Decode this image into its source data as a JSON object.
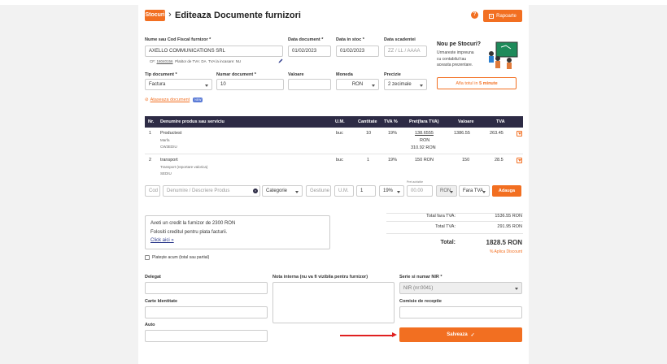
{
  "header": {
    "section_badge": "Stocuri",
    "crumb_edit": "Editeaza",
    "crumb_current": "Documente furnizori",
    "help_glyph": "?",
    "reports_button": "Rapoarte"
  },
  "form": {
    "supplier": {
      "label": "Nume sau Cod Fiscal furnizor *",
      "value": "AXELLO COMMUNICATIONS SRL",
      "cif_prefix": "CF:",
      "cif_value": "18040156",
      "tva_note": "Platitor de TVA: DA",
      "tva_cash": "TVA la incasare: NU"
    },
    "doc_date": {
      "label": "Data document *",
      "value": "01/02/2023"
    },
    "stock_date": {
      "label": "Data in stoc *",
      "value": "01/02/2023"
    },
    "due_date": {
      "label": "Data scadentei",
      "placeholder": "ZZ / LL / AAAA"
    },
    "doc_type": {
      "label": "Tip document *",
      "value": "Factura"
    },
    "doc_number": {
      "label": "Numar document *",
      "value": "10"
    },
    "amount": {
      "label": "Valoare",
      "value": ""
    },
    "currency": {
      "label": "Moneda",
      "value": "RON"
    },
    "precision": {
      "label": "Precizie",
      "value": "2 zecimale"
    },
    "attach": {
      "label": "Ataseaza document",
      "badge": "NEW"
    }
  },
  "promo": {
    "title": "Nou pe Stocuri?",
    "text1": "Urmareste impreuna",
    "text2": "cu contabilul tau",
    "text3": "aceasta prezentare.",
    "button_prefix": "Afla totul in ",
    "button_bold": "5 minute"
  },
  "table": {
    "headers": [
      "Nr.",
      "Denumire produs sau serviciu",
      "U.M.",
      "Cantitate",
      "TVA %",
      "Pret(fara TVA)",
      "Valoare",
      "TVA"
    ],
    "rows": [
      {
        "nr": "1",
        "name": "Productest",
        "type": "Marfa",
        "code": "CW3EDIU",
        "um": "buc",
        "qty": "10",
        "vat": "19%",
        "price": "138.6555",
        "price_cur": "RON",
        "price_note": "310.92 RON",
        "value": "1386.55",
        "vat_value": "263.45"
      },
      {
        "nr": "2",
        "name": "transport",
        "type": "Transport (reportare valorica)",
        "code": "SEDIU",
        "um": "buc",
        "qty": "1",
        "vat": "19%",
        "price": "150 RON",
        "price_cur": "",
        "price_note": "",
        "value": "150",
        "vat_value": "28.5"
      }
    ]
  },
  "add_row": {
    "code_ph": "Cod",
    "name_ph": "Denumire / Descriere Produs",
    "category": "Categorie",
    "location_ph": "Gestiune",
    "um_ph": "U.M.",
    "qty": "1",
    "vat": "19%",
    "price_label": "Pret achizitie",
    "price_ph": "00.00",
    "currency": "RON",
    "vat_mode": "Fara TVA",
    "add_button": "Adauga"
  },
  "totals": {
    "no_vat_label": "Total fara TVA:",
    "no_vat_value": "1536.55 RON",
    "vat_label": "Total TVA:",
    "vat_value": "291.95 RON",
    "total_label": "Total:",
    "total_value": "1828.5 RON",
    "discount": "% Aplica Discount"
  },
  "credit": {
    "line1": "Aveti un credit la furnizor de 2300 RON",
    "line2": "Folositi creditul pentru plata facturii.",
    "link": "Click aici »",
    "paid_label": "Platește acum (total sau partial)"
  },
  "bottom": {
    "delegate_label": "Delegat",
    "id_label": "Carte Identitate",
    "car_label": "Auto",
    "note_label": "Nota interna (nu va fi vizibila pentru furnizor)",
    "nir_label": "Serie si numar NIR *",
    "nir_value": "NIR (nr:0041)",
    "receipt_label": "Comisie de receptie",
    "save_button": "Salveaza"
  },
  "colors": {
    "accent": "#f26f21",
    "table_header": "#2d2b45",
    "arrow": "#e02020"
  }
}
